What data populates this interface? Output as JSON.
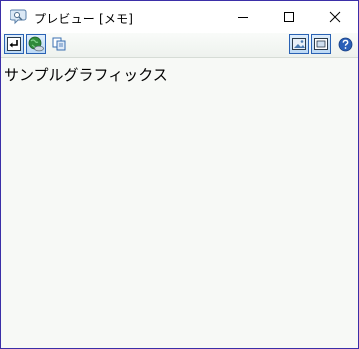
{
  "window": {
    "title": "プレビュー [メモ]",
    "app_icon": "speech-bubble-magnifier-icon",
    "controls": {
      "minimize": "minimize-icon",
      "maximize": "maximize-icon",
      "close": "close-icon"
    }
  },
  "toolbar": {
    "left_buttons": [
      {
        "icon": "return-arrow-icon",
        "pressed": true
      },
      {
        "icon": "globe-icon",
        "pressed": true
      },
      {
        "icon": "copy-icon",
        "pressed": false
      }
    ],
    "right_buttons": [
      {
        "icon": "image-view-icon",
        "pressed": true
      },
      {
        "icon": "fit-window-icon",
        "pressed": true
      },
      {
        "icon": "help-icon",
        "pressed": false
      }
    ]
  },
  "content": {
    "text": "サンプルグラフィックス"
  },
  "colors": {
    "window_border": "#3b2fa8",
    "toolbar_pressed_border": "#2a62b4",
    "content_background": "#f7f9f6"
  }
}
